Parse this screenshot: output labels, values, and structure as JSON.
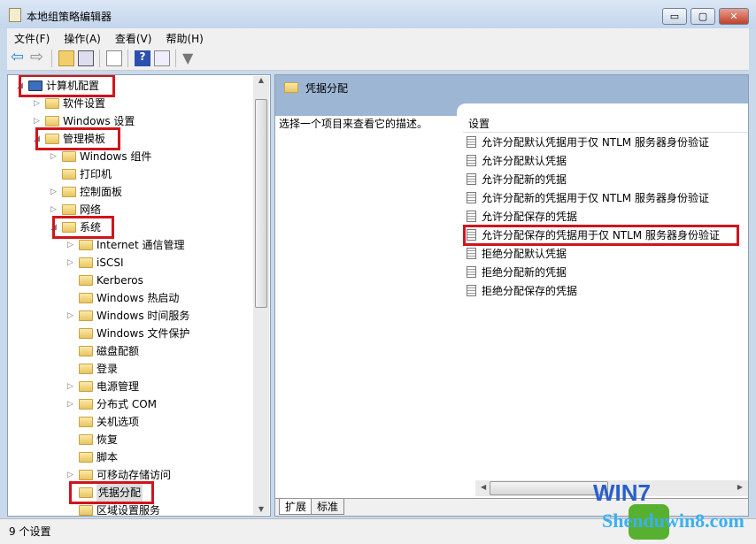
{
  "window": {
    "title": "本地组策略编辑器",
    "minimize": "▭",
    "maximize": "▢",
    "close": "✕"
  },
  "menu": [
    "文件(F)",
    "操作(A)",
    "查看(V)",
    "帮助(H)"
  ],
  "toolbar": [
    "back-icon",
    "forward-icon",
    "up-folder-icon",
    "show-hide-tree-icon",
    "export-list-icon",
    "help-icon",
    "show-action-pane-icon",
    "filter-icon"
  ],
  "tree": [
    {
      "label": "计算机配置",
      "level": 0,
      "state": "expanded",
      "highlight": true
    },
    {
      "label": "软件设置",
      "level": 1,
      "state": "collapsed"
    },
    {
      "label": "Windows 设置",
      "level": 1,
      "state": "collapsed"
    },
    {
      "label": "管理模板",
      "level": 1,
      "state": "expanded",
      "highlight": true
    },
    {
      "label": "Windows 组件",
      "level": 2,
      "state": "collapsed"
    },
    {
      "label": "打印机",
      "level": 2,
      "state": "none"
    },
    {
      "label": "控制面板",
      "level": 2,
      "state": "collapsed"
    },
    {
      "label": "网络",
      "level": 2,
      "state": "collapsed"
    },
    {
      "label": "系统",
      "level": 2,
      "state": "expanded",
      "highlight": true
    },
    {
      "label": "Internet 通信管理",
      "level": 3,
      "state": "collapsed"
    },
    {
      "label": "iSCSI",
      "level": 3,
      "state": "collapsed"
    },
    {
      "label": "Kerberos",
      "level": 3,
      "state": "none"
    },
    {
      "label": "Windows 热启动",
      "level": 3,
      "state": "none"
    },
    {
      "label": "Windows 时间服务",
      "level": 3,
      "state": "collapsed"
    },
    {
      "label": "Windows 文件保护",
      "level": 3,
      "state": "none"
    },
    {
      "label": "磁盘配额",
      "level": 3,
      "state": "none"
    },
    {
      "label": "登录",
      "level": 3,
      "state": "none"
    },
    {
      "label": "电源管理",
      "level": 3,
      "state": "collapsed"
    },
    {
      "label": "分布式 COM",
      "level": 3,
      "state": "collapsed"
    },
    {
      "label": "关机选项",
      "level": 3,
      "state": "none"
    },
    {
      "label": "恢复",
      "level": 3,
      "state": "none"
    },
    {
      "label": "脚本",
      "level": 3,
      "state": "none"
    },
    {
      "label": "可移动存储访问",
      "level": 3,
      "state": "collapsed"
    },
    {
      "label": "凭据分配",
      "level": 3,
      "state": "none",
      "highlight": true,
      "selected": true
    },
    {
      "label": "区域设置服务",
      "level": 3,
      "state": "none"
    }
  ],
  "right": {
    "header": "凭据分配",
    "description": "选择一个项目来查看它的描述。",
    "column": "设置",
    "items": [
      {
        "label": "允许分配默认凭据用于仅 NTLM 服务器身份验证"
      },
      {
        "label": "允许分配默认凭据"
      },
      {
        "label": "允许分配新的凭据"
      },
      {
        "label": "允许分配新的凭据用于仅 NTLM 服务器身份验证"
      },
      {
        "label": "允许分配保存的凭据"
      },
      {
        "label": "允许分配保存的凭据用于仅 NTLM 服务器身份验证",
        "highlight": true
      },
      {
        "label": "拒绝分配默认凭据"
      },
      {
        "label": "拒绝分配新的凭据"
      },
      {
        "label": "拒绝分配保存的凭据"
      }
    ],
    "tabs": [
      "扩展",
      "标准"
    ]
  },
  "status": "9 个设置",
  "watermark": {
    "line1": "WIN7",
    "line2": "Shenduwin8.com"
  },
  "colors": {
    "highlight": "#d0141c",
    "header": "#9db6d3"
  }
}
